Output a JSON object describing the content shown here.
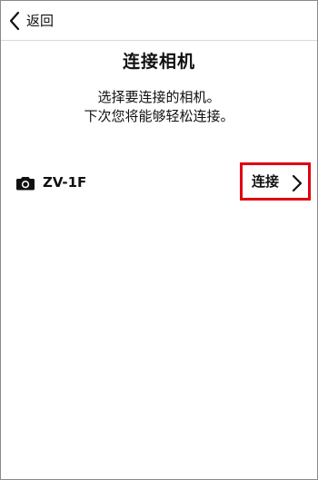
{
  "header": {
    "back_label": "返回"
  },
  "page": {
    "title": "连接相机",
    "instructions": [
      "选择要连接的相机。",
      "下次您将能够轻松连接。"
    ]
  },
  "camera": {
    "name": "ZV-1F",
    "connect_label": "连接"
  },
  "icons": {
    "back": "chevron-left-icon",
    "camera": "camera-icon",
    "connect": "chevron-right-icon"
  },
  "colors": {
    "highlight_border": "#e00012",
    "text": "#111111",
    "divider": "#d9d9d9",
    "background": "#ffffff"
  }
}
